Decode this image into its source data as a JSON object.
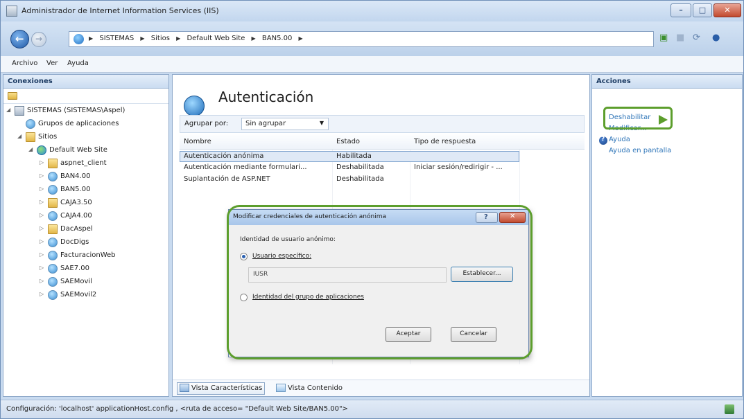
{
  "window": {
    "title": "Administrador de Internet Information Services (IIS)"
  },
  "address": {
    "crumbs": [
      "SISTEMAS",
      "Sitios",
      "Default Web Site",
      "BAN5.00"
    ]
  },
  "menu": [
    "Archivo",
    "Ver",
    "Ayuda"
  ],
  "connections": {
    "header": "Conexiones",
    "tree": [
      {
        "label": "SISTEMAS (SISTEMAS\\Aspel)",
        "icon": "server-icon"
      },
      {
        "label": "Grupos de aplicaciones",
        "icon": "app-pool-icon"
      },
      {
        "label": "Sitios",
        "icon": "folder-icon"
      },
      {
        "label": "Default Web Site",
        "icon": "globe-icon"
      },
      {
        "label": "aspnet_client",
        "icon": "folder-icon"
      },
      {
        "label": "BAN4.00",
        "icon": "app-icon"
      },
      {
        "label": "BAN5.00",
        "icon": "app-icon"
      },
      {
        "label": "CAJA3.50",
        "icon": "folder-icon"
      },
      {
        "label": "CAJA4.00",
        "icon": "app-icon"
      },
      {
        "label": "DacAspel",
        "icon": "folder-icon"
      },
      {
        "label": "DocDigs",
        "icon": "app-icon"
      },
      {
        "label": "FacturacionWeb",
        "icon": "app-icon"
      },
      {
        "label": "SAE7.00",
        "icon": "app-icon"
      },
      {
        "label": "SAEMovil",
        "icon": "app-icon"
      },
      {
        "label": "SAEMovil2",
        "icon": "app-icon"
      }
    ]
  },
  "feature": {
    "title": "Autenticación",
    "group_label": "Agrupar por:",
    "group_value": "Sin agrupar",
    "columns": [
      "Nombre",
      "Estado",
      "Tipo de respuesta"
    ],
    "rows": [
      {
        "name": "Autenticación anónima",
        "state": "Habilitada",
        "response": ""
      },
      {
        "name": "Autenticación mediante formulari...",
        "state": "Deshabilitada",
        "response": "Iniciar sesión/redirigir - ..."
      },
      {
        "name": "Suplantación de ASP.NET",
        "state": "Deshabilitada",
        "response": ""
      }
    ],
    "view_features": "Vista Características",
    "view_content": "Vista Contenido"
  },
  "actions": {
    "header": "Acciones",
    "disable": "Deshabilitar",
    "edit": "Modificar...",
    "help": "Ayuda",
    "help_online": "Ayuda en pantalla"
  },
  "status": {
    "text": "Configuración: 'localhost' applicationHost.config , <ruta de acceso= \"Default Web Site/BAN5.00\">"
  },
  "dialog": {
    "title": "Modificar credenciales de autenticación anónima",
    "identity_label": "Identidad de usuario anónimo:",
    "specific_user": "Usuario específico:",
    "user_value": "IUSR",
    "set_button": "Establecer...",
    "pool_identity": "Identidad del grupo de aplicaciones",
    "ok": "Aceptar",
    "cancel": "Cancelar"
  },
  "colors": {
    "highlight": "#5c9e2c",
    "link": "#2e75b8"
  }
}
